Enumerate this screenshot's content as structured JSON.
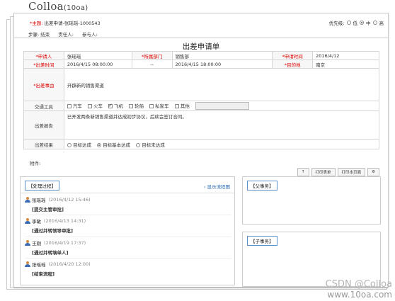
{
  "logo": {
    "name": "Coll",
    "mark": "oa",
    "suffix": "(10oa)"
  },
  "header": {
    "subject_label": "*主题:",
    "subject_value": "出差申请-张瑶瑶-1000543",
    "priority_label": "优先级:",
    "priority_options": [
      "低",
      "中",
      "高"
    ],
    "priority_selected": "中"
  },
  "steps": {
    "step": "步骤: 结束",
    "owner": "责任人:",
    "participant": "参与人:"
  },
  "form": {
    "title": "出差申请单",
    "applicant_label": "*申请人",
    "applicant_value": "张瑶瑶",
    "dept_label": "*所属部门",
    "dept_value": "销售部",
    "apply_time_label": "*申请时间",
    "apply_time_value": "2016/4/12",
    "travel_time_label": "*出差时间",
    "travel_start": "2016/4/15 08:00:00",
    "dash": "--",
    "travel_end": "2016/4/15 18:00:00",
    "destination_label": "*目的地",
    "destination_value": "南京",
    "reason_label": "*出差事由",
    "reason_value": "开辟新的销售渠道",
    "transport_label": "交通工具",
    "transport_options": [
      "汽车",
      "火车",
      "飞机",
      "轮船",
      "私家车",
      "其他"
    ],
    "transport_checked": "飞机",
    "report_label": "出差报告",
    "report_value": "已开发两条新销售渠道并达成初步协议，后续会签订合同。",
    "result_label": "出差结果",
    "result_options": [
      "目标达成",
      "目标基本达成",
      "目标未达成"
    ],
    "result_selected": "目标基本达成"
  },
  "attach_label": "附件:",
  "toolbar": {
    "up": "↑",
    "print_form": "打印表单",
    "print_page": "打印本页面",
    "gear": "⚙"
  },
  "process": {
    "title": "【处理过程】",
    "flow_link": "› 显示流程图",
    "entries": [
      {
        "name": "张瑶瑶",
        "time": "(2016/4/12 15:46)",
        "action": "[提交主管审批]"
      },
      {
        "name": "李敏",
        "time": "(2016/4/13 14:31)",
        "action": "[通过并转领导审批]"
      },
      {
        "name": "王刚",
        "time": "(2016/4/19 17:37)",
        "action": "[通过并转填单人]"
      },
      {
        "name": "张瑶瑶",
        "time": "(2016/4/20 12:00)",
        "action": "[结束流程]"
      }
    ]
  },
  "parent_task": {
    "title": "【父事务】"
  },
  "child_task": {
    "title": "【子事务】"
  },
  "watermark": {
    "line1": "CSDN @Colloa",
    "line2": "www.10oa.com"
  }
}
